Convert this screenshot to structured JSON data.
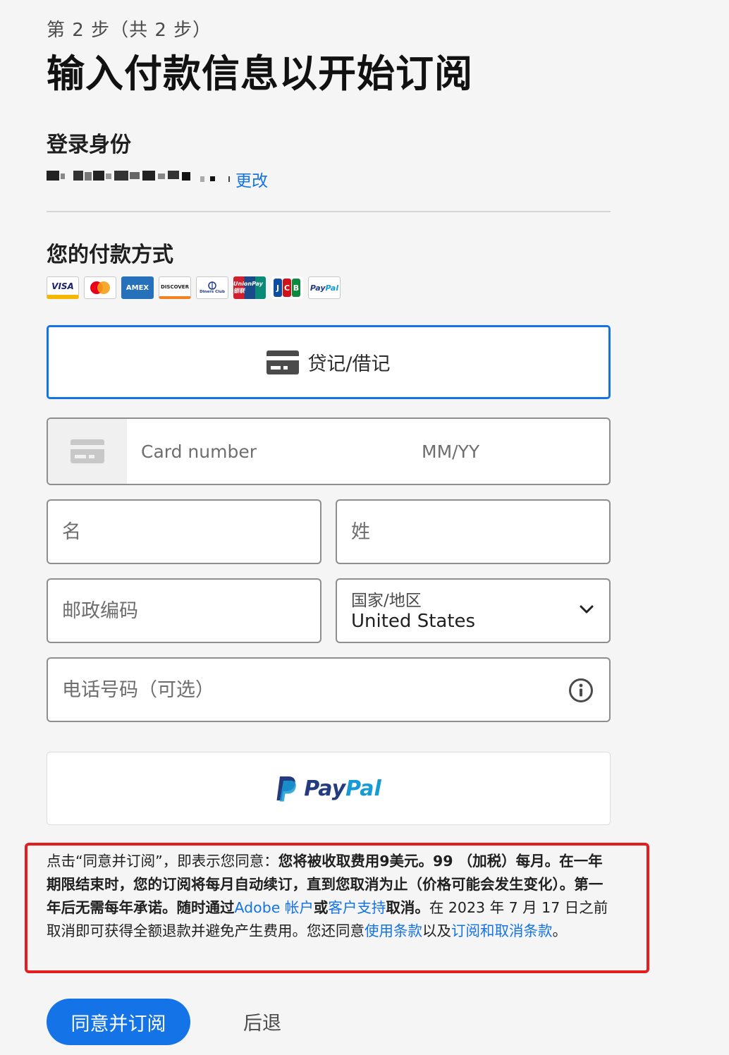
{
  "header": {
    "step": "第 2 步（共 2 步）",
    "title": "输入付款信息以开始订阅"
  },
  "signin": {
    "title": "登录身份",
    "change_link": "更改"
  },
  "payment": {
    "title": "您的付款方式",
    "logos": {
      "visa": "VISA",
      "amex": "AMEX",
      "discover": "DISCOVER",
      "diners": "Diners Club",
      "unionpay": "UnionPay 银联",
      "jcb": [
        "J",
        "C",
        "B"
      ],
      "paypal": [
        "Pay",
        "Pal"
      ]
    },
    "credit_button": "贷记/借记",
    "card_number_placeholder": "Card number",
    "expiry_placeholder": "MM/YY",
    "first_name_placeholder": "名",
    "last_name_placeholder": "姓",
    "zip_placeholder": "邮政编码",
    "country_label": "国家/地区",
    "country_value": "United States",
    "phone_placeholder": "电话号码（可选）",
    "paypal_button": [
      "Pay",
      "Pal"
    ]
  },
  "terms": {
    "p1": "点击“同意并订阅”，即表示您同意：",
    "b1": "您将被收取费用9美元。99 （加税）每月。在一年期限结束时，您的订阅将每月自动续订，直到您取消为止（价格可能会发生变化）。第一年后无需每年承诺。随时通过",
    "link_account": "Adobe 帐户",
    "b2": "或",
    "link_support": "客户支持",
    "b3": "取消。",
    "p2": "在 2023 年 7 月 17 日之前取消即可获得全额退款并避免产生费用。您还同意",
    "link_terms": "使用条款",
    "p3": "以及",
    "link_cancel": "订阅和取消条款",
    "p4": "。"
  },
  "actions": {
    "agree": "同意并订阅",
    "back": "后退"
  },
  "colors": {
    "accent": "#1473e6",
    "highlight": "#e41e1e"
  }
}
